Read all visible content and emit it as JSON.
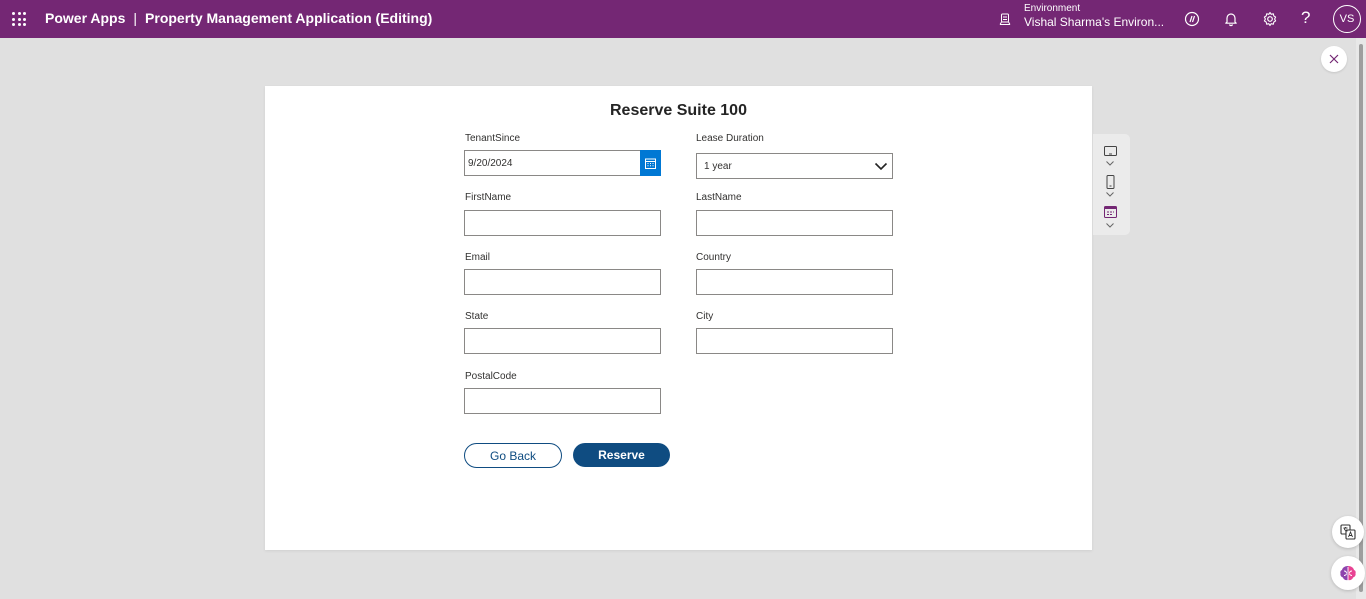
{
  "header": {
    "product": "Power Apps",
    "separator": "|",
    "app_title": "Property Management Application (Editing)",
    "environment_label": "Environment",
    "environment_name": "Vishal Sharma's Environ...",
    "help": "?",
    "avatar_initials": "VS"
  },
  "form": {
    "title": "Reserve Suite 100",
    "fields": {
      "tenant_since": {
        "label": "TenantSince",
        "value": "9/20/2024"
      },
      "lease_duration": {
        "label": "Lease Duration",
        "value": "1 year"
      },
      "first_name": {
        "label": "FirstName",
        "value": ""
      },
      "last_name": {
        "label": "LastName",
        "value": ""
      },
      "email": {
        "label": "Email",
        "value": ""
      },
      "country": {
        "label": "Country",
        "value": ""
      },
      "state": {
        "label": "State",
        "value": ""
      },
      "city": {
        "label": "City",
        "value": ""
      },
      "postal_code": {
        "label": "PostalCode",
        "value": ""
      }
    },
    "buttons": {
      "go_back": "Go Back",
      "reserve": "Reserve"
    }
  },
  "colors": {
    "header_bg": "#742774",
    "primary_button": "#0f4c81",
    "calendar_button": "#0078d4"
  },
  "icons": [
    "waffle-icon",
    "environment-icon",
    "copilot-icon",
    "bell-icon",
    "gear-icon",
    "help-icon",
    "close-icon",
    "calendar-icon",
    "chevron-down-icon",
    "tablet-icon",
    "phone-icon",
    "calendar-view-icon",
    "translate-icon",
    "brain-icon"
  ]
}
